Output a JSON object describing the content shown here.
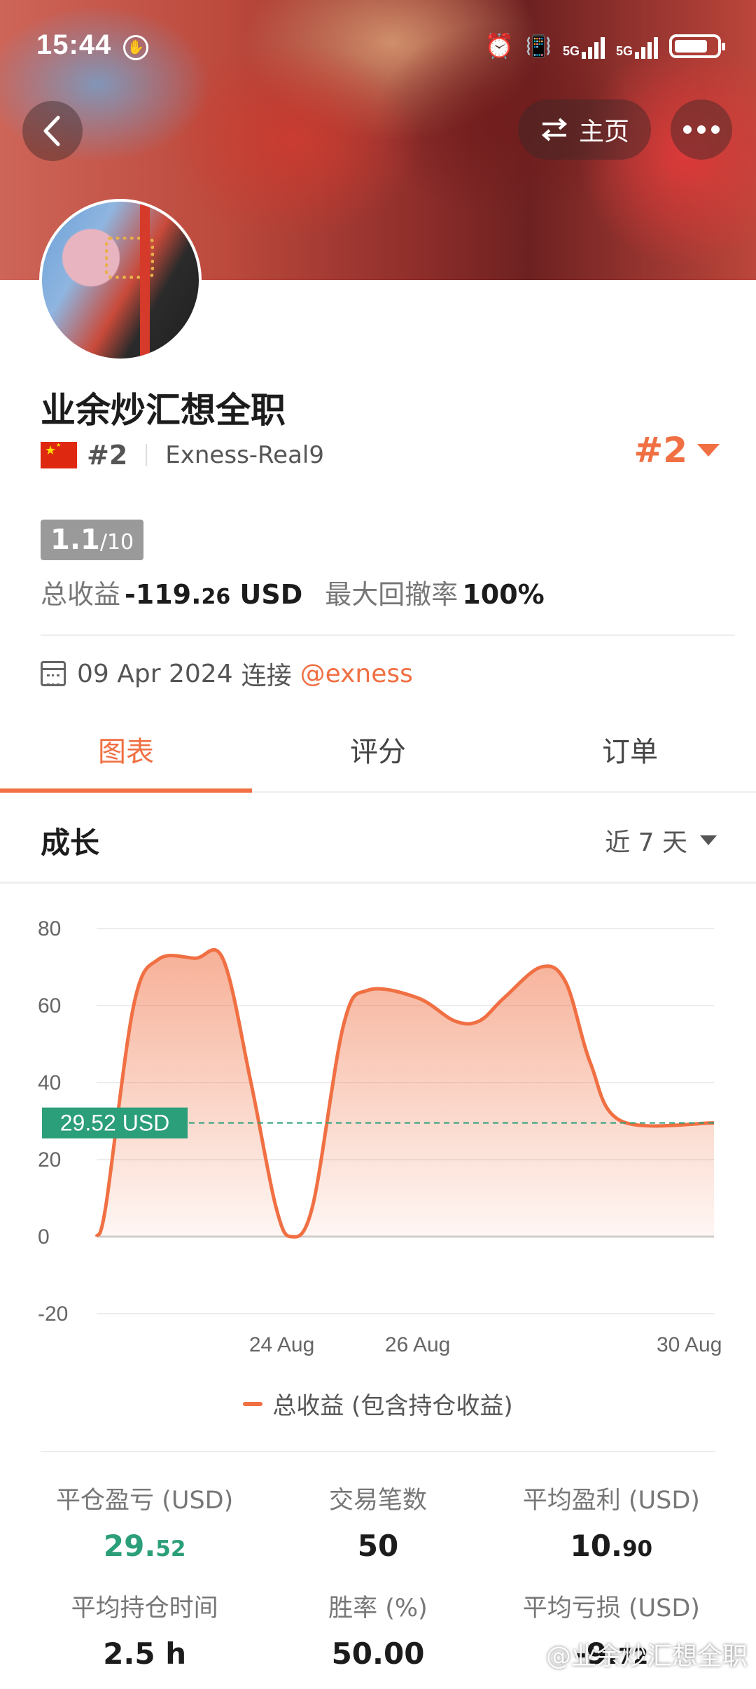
{
  "status_bar": {
    "time": "15:44",
    "network_1": "5G",
    "network_2": "5G",
    "battery_level": 0.8
  },
  "header": {
    "back_icon": "chevron-left-icon",
    "home_label": "主页",
    "swap_icon": "swap-icon",
    "more_icon": "more-dots-icon"
  },
  "profile": {
    "name": "业余炒汇想全职",
    "rank_small": "#2",
    "broker": "Exness-Real9",
    "rank_big": "#2",
    "score": "1.1",
    "score_max": "/10",
    "total_profit_label": "总收益",
    "total_profit_main": "-119.",
    "total_profit_dec": "26",
    "total_profit_unit": " USD",
    "max_drawdown_label": "最大回撤率",
    "max_drawdown_value": "100%",
    "connect_date": "09 Apr 2024",
    "connect_text": "连接",
    "connect_link": "@exness"
  },
  "tabs": [
    {
      "label": "图表",
      "active": true
    },
    {
      "label": "评分",
      "active": false
    },
    {
      "label": "订单",
      "active": false
    }
  ],
  "section": {
    "title": "成长",
    "range_label": "近 7 天"
  },
  "chart_data": {
    "type": "area",
    "title": "成长",
    "series": [
      {
        "name": "总收益 (包含持仓收益)",
        "color": "#f07043",
        "points": [
          [
            0,
            0
          ],
          [
            0.15,
            8
          ],
          [
            0.6,
            60
          ],
          [
            1.0,
            72
          ],
          [
            1.6,
            72.3
          ],
          [
            2.05,
            72
          ],
          [
            2.5,
            40
          ],
          [
            2.9,
            8
          ],
          [
            3.15,
            0
          ],
          [
            3.5,
            8
          ],
          [
            4.0,
            55
          ],
          [
            4.4,
            64
          ],
          [
            5.2,
            62
          ],
          [
            5.8,
            56
          ],
          [
            6.2,
            56
          ],
          [
            6.6,
            62
          ],
          [
            7.2,
            70
          ],
          [
            7.6,
            66
          ],
          [
            8.0,
            45
          ],
          [
            8.5,
            30
          ],
          [
            10.0,
            29.52
          ]
        ]
      }
    ],
    "reference_line": {
      "value": 29.52,
      "label": "29.52 USD",
      "color": "#2b9e7a"
    },
    "x_ticks": [
      {
        "pos": 3.0,
        "label": "24 Aug"
      },
      {
        "pos": 5.2,
        "label": "26 Aug"
      },
      {
        "pos": 9.6,
        "label": "30 Aug"
      }
    ],
    "y_ticks": [
      80,
      60,
      40,
      20,
      0,
      -20
    ],
    "ylim": [
      -20,
      80
    ],
    "xlim": [
      0,
      10
    ],
    "legend_position": "bottom",
    "grid": true
  },
  "stats": [
    {
      "label": "平仓盈亏 (USD)",
      "int": "29.",
      "dec": "52",
      "tone": "positive"
    },
    {
      "label": "交易笔数",
      "int": "50",
      "dec": "",
      "tone": "normal"
    },
    {
      "label": "平均盈利 (USD)",
      "int": "10.",
      "dec": "90",
      "tone": "normal"
    },
    {
      "label": "平均持仓时间",
      "int": "2.5 h",
      "dec": "",
      "tone": "normal"
    },
    {
      "label": "胜率 (%)",
      "int": "50.00",
      "dec": "",
      "tone": "normal"
    },
    {
      "label": "平均亏损 (USD)",
      "int": "-9.",
      "dec": "72",
      "tone": "normal"
    }
  ],
  "watermark": "@业余炒汇想全职"
}
